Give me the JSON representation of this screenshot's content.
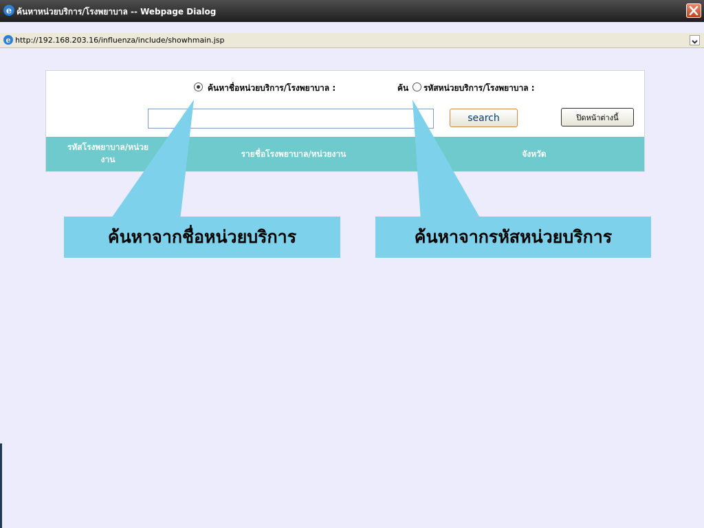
{
  "window": {
    "title": "ค้นหาหน่วยบริการ/โรงพยาบาล -- Webpage Dialog",
    "url": "http://192.168.203.16/influenza/include/showhmain.jsp"
  },
  "search": {
    "option_name_label": "ค้นหาชื่อหน่วยบริการ/โรงพยาบาล :",
    "option_name_selected": true,
    "option_code_prefix": "ค้น",
    "option_code_label": "รหัสหน่วยบริการ/โรงพยาบาล :",
    "option_code_selected": false,
    "input_value": "",
    "search_button": "search",
    "close_button": "ปิดหน้าต่างนี้"
  },
  "table": {
    "headers": [
      {
        "line1": "รหัสโรงพยาบาล/หน่วย",
        "line2": "งาน"
      },
      {
        "line1": "รายชื่อโรงพยาบาล/หน่วยงาน",
        "line2": ""
      },
      {
        "line1": "จังหวัด",
        "line2": ""
      }
    ]
  },
  "callouts": {
    "by_name": "ค้นหาจากชื่อหน่วยบริการ",
    "by_code": "ค้นหาจากรหัสหน่วยบริการ"
  },
  "colors": {
    "header_bg": "#6ECACC",
    "callout_bg": "#7DD1EA",
    "page_bg": "#ECECFC"
  }
}
